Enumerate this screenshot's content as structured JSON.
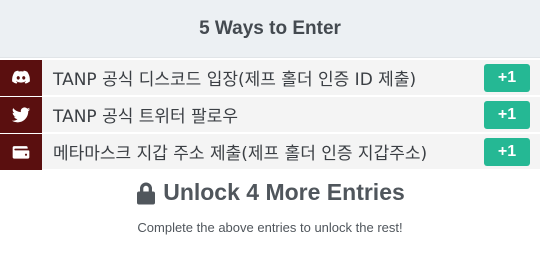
{
  "header": {
    "title": "5 Ways to Enter"
  },
  "entries": [
    {
      "icon": "discord-icon",
      "label": "TANP 공식 디스코드 입장(제프 홀더 인증 ID 제출)",
      "points": "+1"
    },
    {
      "icon": "twitter-icon",
      "label": "TANP 공식 트위터 팔로우",
      "points": "+1"
    },
    {
      "icon": "wallet-icon",
      "label": "메타마스크 지갑 주소 제출(제프 홀더 인증 지갑주소)",
      "points": "+1"
    }
  ],
  "unlock": {
    "icon": "lock-icon",
    "title": "Unlock 4 More Entries",
    "subtitle": "Complete the above entries to unlock the rest!"
  },
  "colors": {
    "header_bg": "#ecf0f3",
    "icon_bg": "#5a0f0f",
    "button_bg": "#25b894",
    "text": "#3b3f44"
  }
}
